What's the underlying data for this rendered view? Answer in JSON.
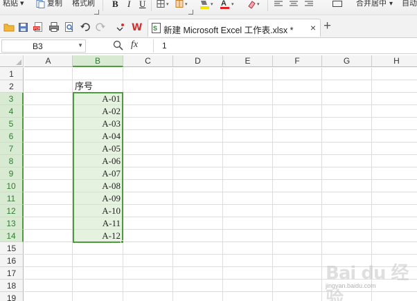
{
  "ribbon": {
    "paste_label": "粘贴",
    "copy_label": "复制",
    "format_painter_label": "格式刷",
    "bold_label": "B",
    "italic_label": "I",
    "underline_label": "U",
    "merge_center_label": "合并居中",
    "auto_wrap_label": "自动"
  },
  "tabs": {
    "document_title": "新建 Microsoft Excel 工作表.xlsx *",
    "close_glyph": "×",
    "new_tab_glyph": "+"
  },
  "formula_bar": {
    "cell_reference": "B3",
    "fx_label": "fx",
    "formula_value": "1"
  },
  "sheet": {
    "columns": [
      "A",
      "B",
      "C",
      "D",
      "E",
      "F",
      "G",
      "H"
    ],
    "selected_column": "B",
    "rows": [
      "1",
      "2",
      "3",
      "4",
      "5",
      "6",
      "7",
      "8",
      "9",
      "10",
      "11",
      "12",
      "13",
      "14",
      "15",
      "16",
      "17",
      "18",
      "19"
    ],
    "selected_rows": [
      "3",
      "4",
      "5",
      "6",
      "7",
      "8",
      "9",
      "10",
      "11",
      "12",
      "13",
      "14"
    ],
    "header_cell": {
      "ref": "B2",
      "value": "序号"
    },
    "values": [
      {
        "ref": "B3",
        "value": "A-01"
      },
      {
        "ref": "B4",
        "value": "A-02"
      },
      {
        "ref": "B5",
        "value": "A-03"
      },
      {
        "ref": "B6",
        "value": "A-04"
      },
      {
        "ref": "B7",
        "value": "A-05"
      },
      {
        "ref": "B8",
        "value": "A-06"
      },
      {
        "ref": "B9",
        "value": "A-07"
      },
      {
        "ref": "B10",
        "value": "A-08"
      },
      {
        "ref": "B11",
        "value": "A-09"
      },
      {
        "ref": "B12",
        "value": "A-10"
      },
      {
        "ref": "B13",
        "value": "A-11"
      },
      {
        "ref": "B14",
        "value": "A-12"
      }
    ]
  },
  "watermark": {
    "logo": "Bai du 经验",
    "url": "jingyan.baidu.com"
  },
  "colors": {
    "selection_border": "#4d9a3f",
    "selection_fill": "#e6f2e0",
    "selected_header_fill": "#d8ead1",
    "selected_header_text": "#2e7d32",
    "wps_red": "#d0312d"
  },
  "icons": [
    "paste-icon",
    "copy-icon",
    "format-painter-icon",
    "borders-icon",
    "fill-color-icon",
    "font-color-icon",
    "clear-icon",
    "align-left-icon",
    "align-center-icon",
    "align-right-icon",
    "open-folder-icon",
    "save-icon",
    "pdf-export-icon",
    "print-icon",
    "print-preview-icon",
    "undo-icon",
    "redo-icon",
    "wps-logo-icon",
    "excel-file-icon",
    "zoom-function-icon"
  ]
}
